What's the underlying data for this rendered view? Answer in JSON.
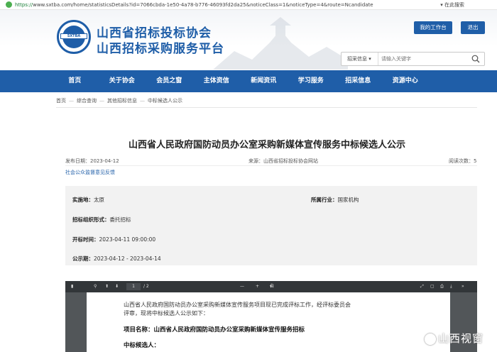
{
  "browser": {
    "scheme": "https://",
    "url_rest": "www.sxtba.com/home/statisticsDetails?id=7066cbda-1e50-4a78-b776-46093fd2da25&noticeClass=1&noticeType=4&route=Ncandidate",
    "menu_button": "在此搜索"
  },
  "header": {
    "logo_text": "SXTBA",
    "title_line1": "山西省招标投标协会",
    "title_line2": "山西招标采购服务平台",
    "workbench_button": "我的工作台",
    "logout_button": "退出"
  },
  "search": {
    "category": "招采信息",
    "placeholder": "请输入关键字"
  },
  "nav": [
    "首页",
    "关于协会",
    "会员之窗",
    "主体资信",
    "新闻资讯",
    "学习服务",
    "招采信息",
    "资源中心"
  ],
  "breadcrumb": [
    "首页",
    "综合查询",
    "其他招标信息",
    "中标候选人公示"
  ],
  "article": {
    "title": "山西省人民政府国防动员办公室采购新媒体宣传服务中标候选人公示",
    "publish_date": "发布日期：2023-04-12",
    "source": "来源：山西省招标投标协会网站",
    "views": "阅读次数：5",
    "feedback_link": "社会公众监督意见反馈"
  },
  "info": {
    "location_label": "实施地：",
    "location_value": "太原",
    "industry_label": "所属行业：",
    "industry_value": "国家机构",
    "org_form_label": "招标组织形式：",
    "org_form_value": "委托招标",
    "bid_open_label": "开标时间：",
    "bid_open_value": "2023-04-11 09:00:00",
    "notice_period_label": "公示期：",
    "notice_period_value": "2023-04-12 - 2023-04-14"
  },
  "pdf": {
    "page_current": "1",
    "page_total": "/ 2",
    "zoom": "自动缩放",
    "para1_line1": "山西省人民政府国防动员办公室采购新媒体宣传服务项目现已完成评标工作，经评标委员会",
    "para1_line2": "评审，现将中标候选人公示如下：",
    "project_line": "项目名称：山西省人民政府国防动员办公室采购新媒体宣传服务招标",
    "candidate_line": "中标候选人："
  },
  "watermark": "山西视窗"
}
